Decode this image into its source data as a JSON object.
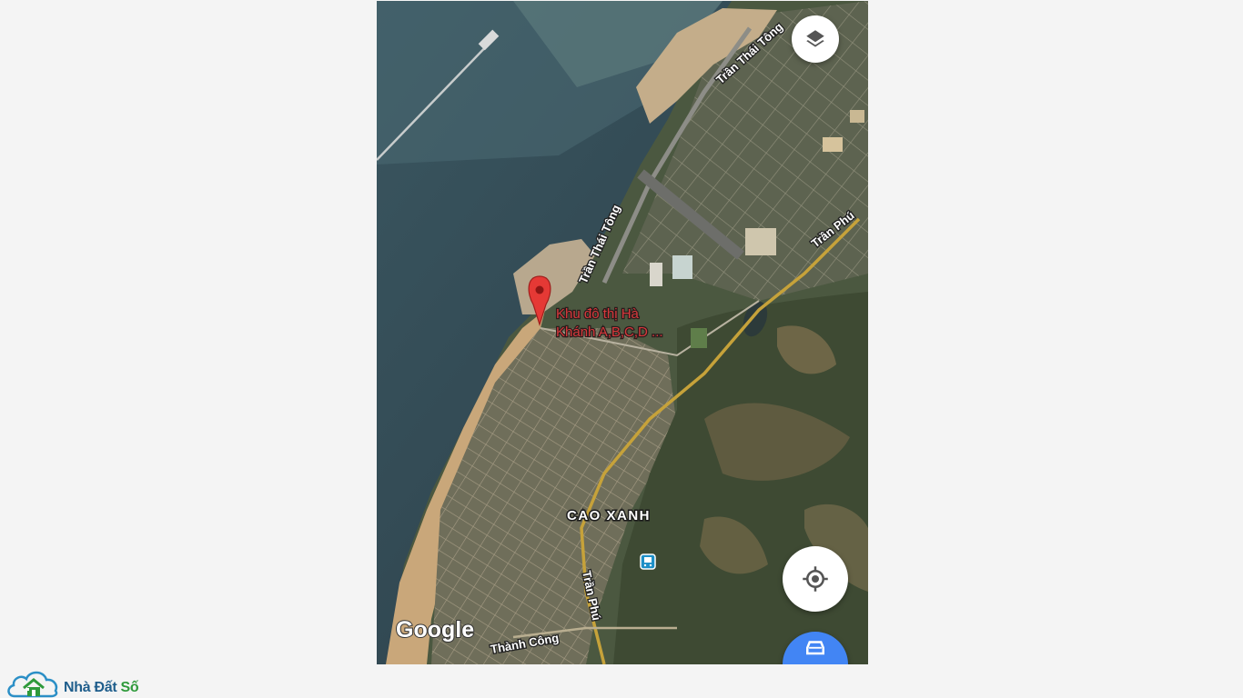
{
  "map": {
    "roads": [
      {
        "id": "tran-thai-tong-north",
        "label": "Trần Thái Tông"
      },
      {
        "id": "tran-thai-tong-south",
        "label": "Trần Thái Tông"
      },
      {
        "id": "tran-phu-east",
        "label": "Trần Phú"
      },
      {
        "id": "tran-phu-south",
        "label": "Trần Phú"
      },
      {
        "id": "thanh-cong",
        "label": "Thành Công"
      }
    ],
    "area_label": "CAO XANH",
    "marker": {
      "line1": "Khu đô thị Hà",
      "line2": "Khánh A,B,C,D ..."
    },
    "attribution": "Google",
    "controls": {
      "layers_icon": "layers-icon",
      "locate_icon": "my-location-icon",
      "directions_icon": "car-icon"
    },
    "colors": {
      "water": "#2f4650",
      "marker": "#e53935",
      "place_text": "#d6393c",
      "directions_fab": "#4285f4"
    }
  },
  "brand": {
    "name_part1": "Nhà Đất ",
    "name_part2": "Số",
    "icon": "cloud-house-icon"
  }
}
